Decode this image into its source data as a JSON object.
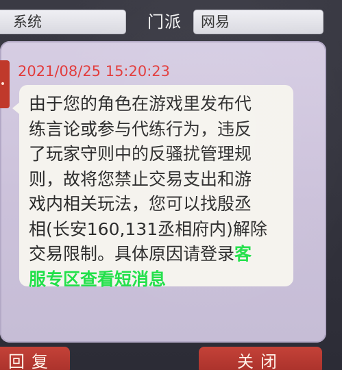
{
  "header": {
    "channel_value": "系统",
    "faction_label": "门派",
    "faction_value": "网易"
  },
  "message": {
    "timestamp": "2021/08/25 15:20:23",
    "lines": [
      "由于您的角色在游戏里发布代",
      "练言论或参与代练行为，违反",
      "了玩家守则中的反骚扰管理规",
      "则，故将您禁止交易支出和游",
      "戏内相关玩法，您可以找殷丞",
      "相(长安160,131丞相府内)解除",
      "交易限制。具体原因请登录"
    ],
    "link_part1": "客",
    "link_part2": "服专区查看短消息"
  },
  "buttons": {
    "reply_label": "回复",
    "close_label": "关闭"
  },
  "colors": {
    "timestamp": "#e23a3a",
    "link": "#22e04a",
    "panel": "#d6cde3",
    "button": "#c44238"
  }
}
